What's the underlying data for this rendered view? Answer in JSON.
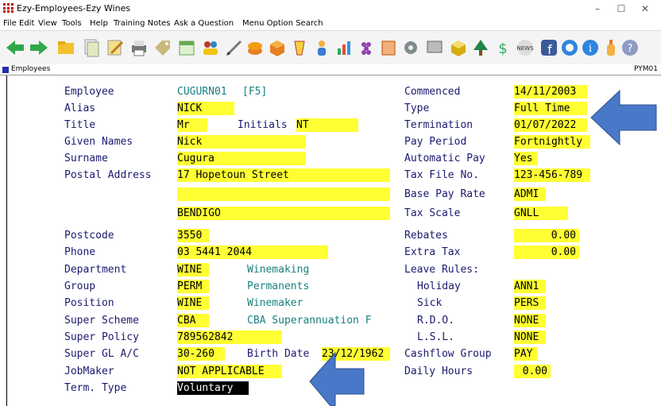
{
  "window": {
    "title": "Ezy-Employees-Ezy Wines",
    "minimize": "–",
    "maximize": "☐",
    "close": "✕"
  },
  "menu": [
    "File",
    "Edit",
    "View",
    "Tools",
    "Help",
    "Training Notes",
    "Ask a Question",
    "Menu Option Search"
  ],
  "toolbar_icons": [
    "back-arrow-icon",
    "forward-arrow-icon",
    "folder-icon",
    "documents-icon",
    "edit-icon",
    "printer-icon",
    "tag-icon",
    "calendar-icon",
    "users-icon",
    "pen-icon",
    "coins-icon",
    "box-icon",
    "drink-icon",
    "person-icon",
    "chart-icon",
    "grapes-icon",
    "document-icon",
    "settings-icon",
    "screen-icon",
    "package-icon",
    "tree-icon",
    "money-icon",
    "news-icon",
    "facebook-icon",
    "refresh-icon",
    "info-icon",
    "bottle-icon",
    "help-icon"
  ],
  "screen": {
    "label": "Employees",
    "code": "PYM01"
  },
  "form": {
    "employee_label": "Employee",
    "employee_value": "CUGURN01",
    "employee_key": "[F5]",
    "alias_label": "Alias",
    "alias_value": "NICK",
    "title_label": "Title",
    "title_value": "Mr",
    "initials_label": "Initials",
    "initials_value": "NT",
    "given_label": "Given Names",
    "given_value": "Nick",
    "surname_label": "Surname",
    "surname_value": "Cugura",
    "postal_label": "Postal Address",
    "postal_line1": "17 Hopetoun Street",
    "postal_line2": "",
    "postal_line3": "BENDIGO",
    "postcode_label": "Postcode",
    "postcode_value": "3550",
    "phone_label": "Phone",
    "phone_value": "03 5441 2044",
    "department_label": "Department",
    "department_value": "WINE",
    "department_desc": "Winemaking",
    "group_label": "Group",
    "group_value": "PERM",
    "group_desc": "Permanents",
    "position_label": "Position",
    "position_value": "WINE",
    "position_desc": "Winemaker",
    "super_scheme_label": "Super Scheme",
    "super_scheme_value": "CBA",
    "super_scheme_desc": "CBA Superannuation F",
    "super_policy_label": "Super Policy",
    "super_policy_value": "789562842",
    "super_gl_label": "Super GL A/C",
    "super_gl_value": "30-260",
    "birth_label": "Birth Date",
    "birth_value": "23/12/1962",
    "jobmaker_label": "JobMaker",
    "jobmaker_value": "NOT APPLICABLE",
    "term_type_label": "Term. Type",
    "term_type_value": "Voluntary",
    "commenced_label": "Commenced",
    "commenced_value": "14/11/2003",
    "type_label": "Type",
    "type_value": "Full Time",
    "termination_label": "Termination",
    "termination_value": "01/07/2022",
    "pay_period_label": "Pay Period",
    "pay_period_value": "Fortnightly",
    "auto_pay_label": "Automatic Pay",
    "auto_pay_value": "Yes",
    "tax_file_label": "Tax File No.",
    "tax_file_value": "123-456-789",
    "base_rate_label": "Base Pay Rate",
    "base_rate_value": "ADMI",
    "tax_scale_label": "Tax Scale",
    "tax_scale_value": "GNLL",
    "rebates_label": "Rebates",
    "rebates_value": "0.00",
    "extra_tax_label": "Extra Tax",
    "extra_tax_value": "0.00",
    "leave_rules_label": "Leave Rules:",
    "holiday_label": "Holiday",
    "holiday_value": "ANN1",
    "sick_label": "Sick",
    "sick_value": "PERS",
    "rdo_label": "R.D.O.",
    "rdo_value": "NONE",
    "lsl_label": "L.S.L.",
    "lsl_value": "NONE",
    "cashflow_label": "Cashflow Group",
    "cashflow_value": "PAY",
    "daily_hours_label": "Daily Hours",
    "daily_hours_value": "0.00"
  },
  "colors": {
    "field_bg": "#ffff33",
    "label": "#1a1a6e",
    "description": "#1a8080",
    "callout_arrow": "#4a78c8"
  }
}
